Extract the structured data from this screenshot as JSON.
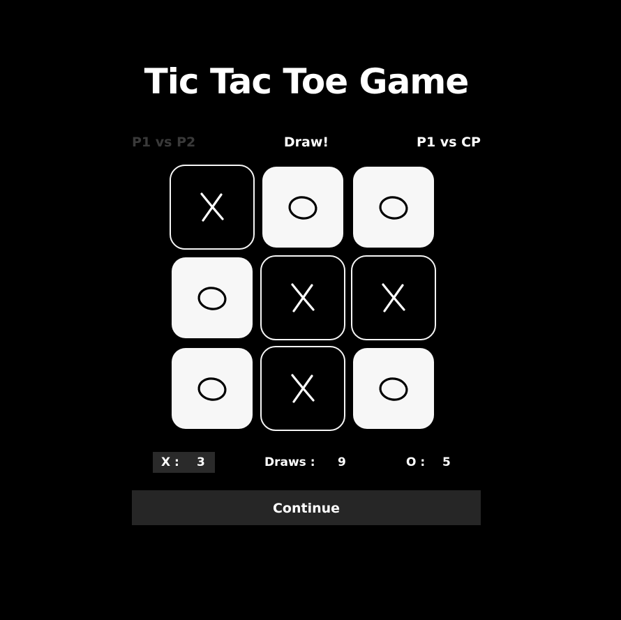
{
  "title": "Tic Tac Toe Game",
  "modes": {
    "left": "P1 vs P2",
    "status": "Draw!",
    "right": "P1 vs CP"
  },
  "board": [
    [
      "X",
      "O",
      "O"
    ],
    [
      "O",
      "X",
      "X"
    ],
    [
      "O",
      "X",
      "O"
    ]
  ],
  "score": {
    "x_label": "X :",
    "x_value": "3",
    "draws_label": "Draws :",
    "draws_value": "9",
    "o_label": "O :",
    "o_value": "5"
  },
  "continue_label": "Continue",
  "colors": {
    "background": "#000000",
    "o_cell": "#f7f7f7",
    "x_cell_border": "#f5f5f5",
    "inactive_mode": "#3a3a3a",
    "panel": "#262626"
  },
  "icons": {
    "x": "x-mark-icon",
    "o": "o-mark-icon"
  }
}
